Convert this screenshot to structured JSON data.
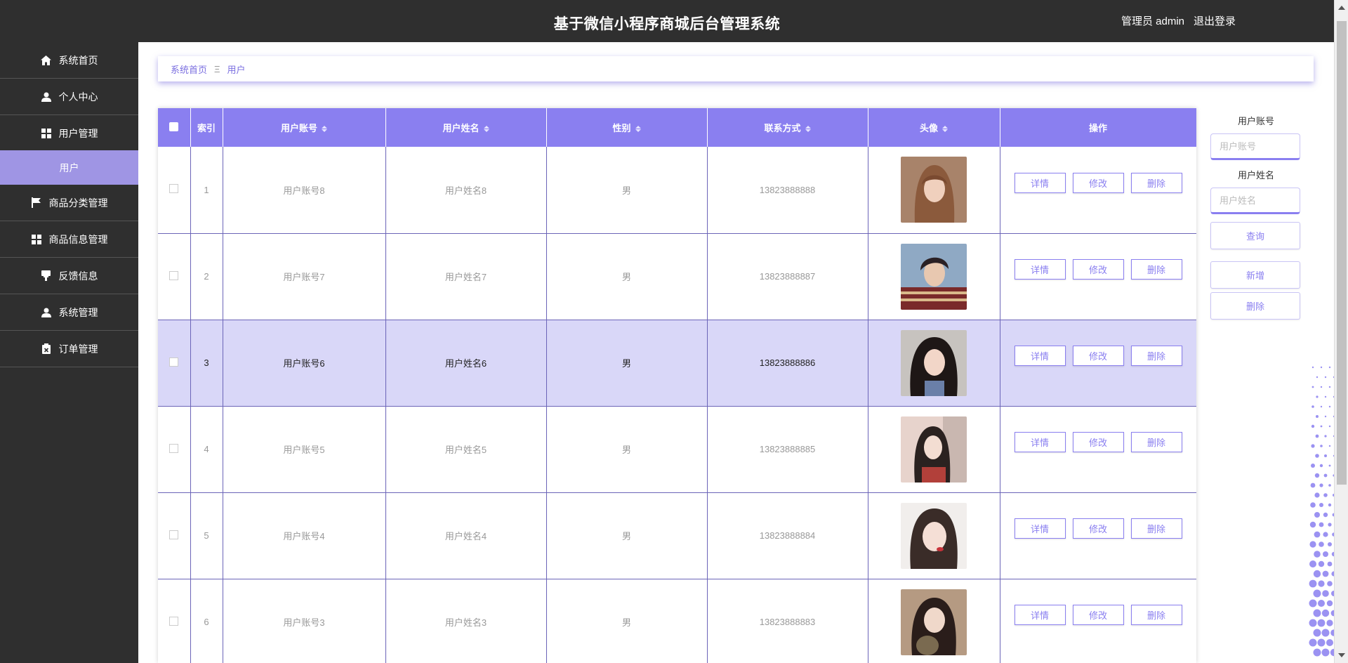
{
  "header": {
    "title": "基于微信小程序商城后台管理系统",
    "user_label": "管理员 admin",
    "logout": "退出登录"
  },
  "sidebar": {
    "items": [
      {
        "label": "系统首页",
        "icon": "home-icon"
      },
      {
        "label": "个人中心",
        "icon": "user-icon"
      },
      {
        "label": "用户管理",
        "icon": "grid-icon"
      },
      {
        "label": "用户",
        "icon": ""
      },
      {
        "label": "商品分类管理",
        "icon": "flag-icon"
      },
      {
        "label": "商品信息管理",
        "icon": "grid-icon"
      },
      {
        "label": "反馈信息",
        "icon": "feedback-icon"
      },
      {
        "label": "系统管理",
        "icon": "user-icon"
      },
      {
        "label": "订单管理",
        "icon": "clipboard-icon"
      }
    ],
    "active_index": 3
  },
  "breadcrumb": {
    "home": "系统首页",
    "separator": "Ξ",
    "current": "用户"
  },
  "table": {
    "columns": [
      "索引",
      "用户账号",
      "用户姓名",
      "性别",
      "联系方式",
      "头像",
      "操作"
    ],
    "rows": [
      {
        "index": "1",
        "account": "用户账号8",
        "name": "用户姓名8",
        "gender": "男",
        "phone": "13823888888"
      },
      {
        "index": "2",
        "account": "用户账号7",
        "name": "用户姓名7",
        "gender": "男",
        "phone": "13823888887"
      },
      {
        "index": "3",
        "account": "用户账号6",
        "name": "用户姓名6",
        "gender": "男",
        "phone": "13823888886"
      },
      {
        "index": "4",
        "account": "用户账号5",
        "name": "用户姓名5",
        "gender": "男",
        "phone": "13823888885"
      },
      {
        "index": "5",
        "account": "用户账号4",
        "name": "用户姓名4",
        "gender": "男",
        "phone": "13823888884"
      },
      {
        "index": "6",
        "account": "用户账号3",
        "name": "用户姓名3",
        "gender": "男",
        "phone": "13823888883"
      }
    ],
    "selected_row": 2,
    "actions": {
      "detail": "详情",
      "edit": "修改",
      "delete": "删除"
    }
  },
  "filter": {
    "account_label": "用户账号",
    "account_placeholder": "用户账号",
    "name_label": "用户姓名",
    "name_placeholder": "用户姓名",
    "query": "查询",
    "add": "新增",
    "delete": "删除"
  },
  "colors": {
    "accent": "#8a7ff0",
    "sidebar_bg": "#2f2f2f",
    "active_item": "#9f95e4",
    "selected_row": "#d9d7f8"
  }
}
